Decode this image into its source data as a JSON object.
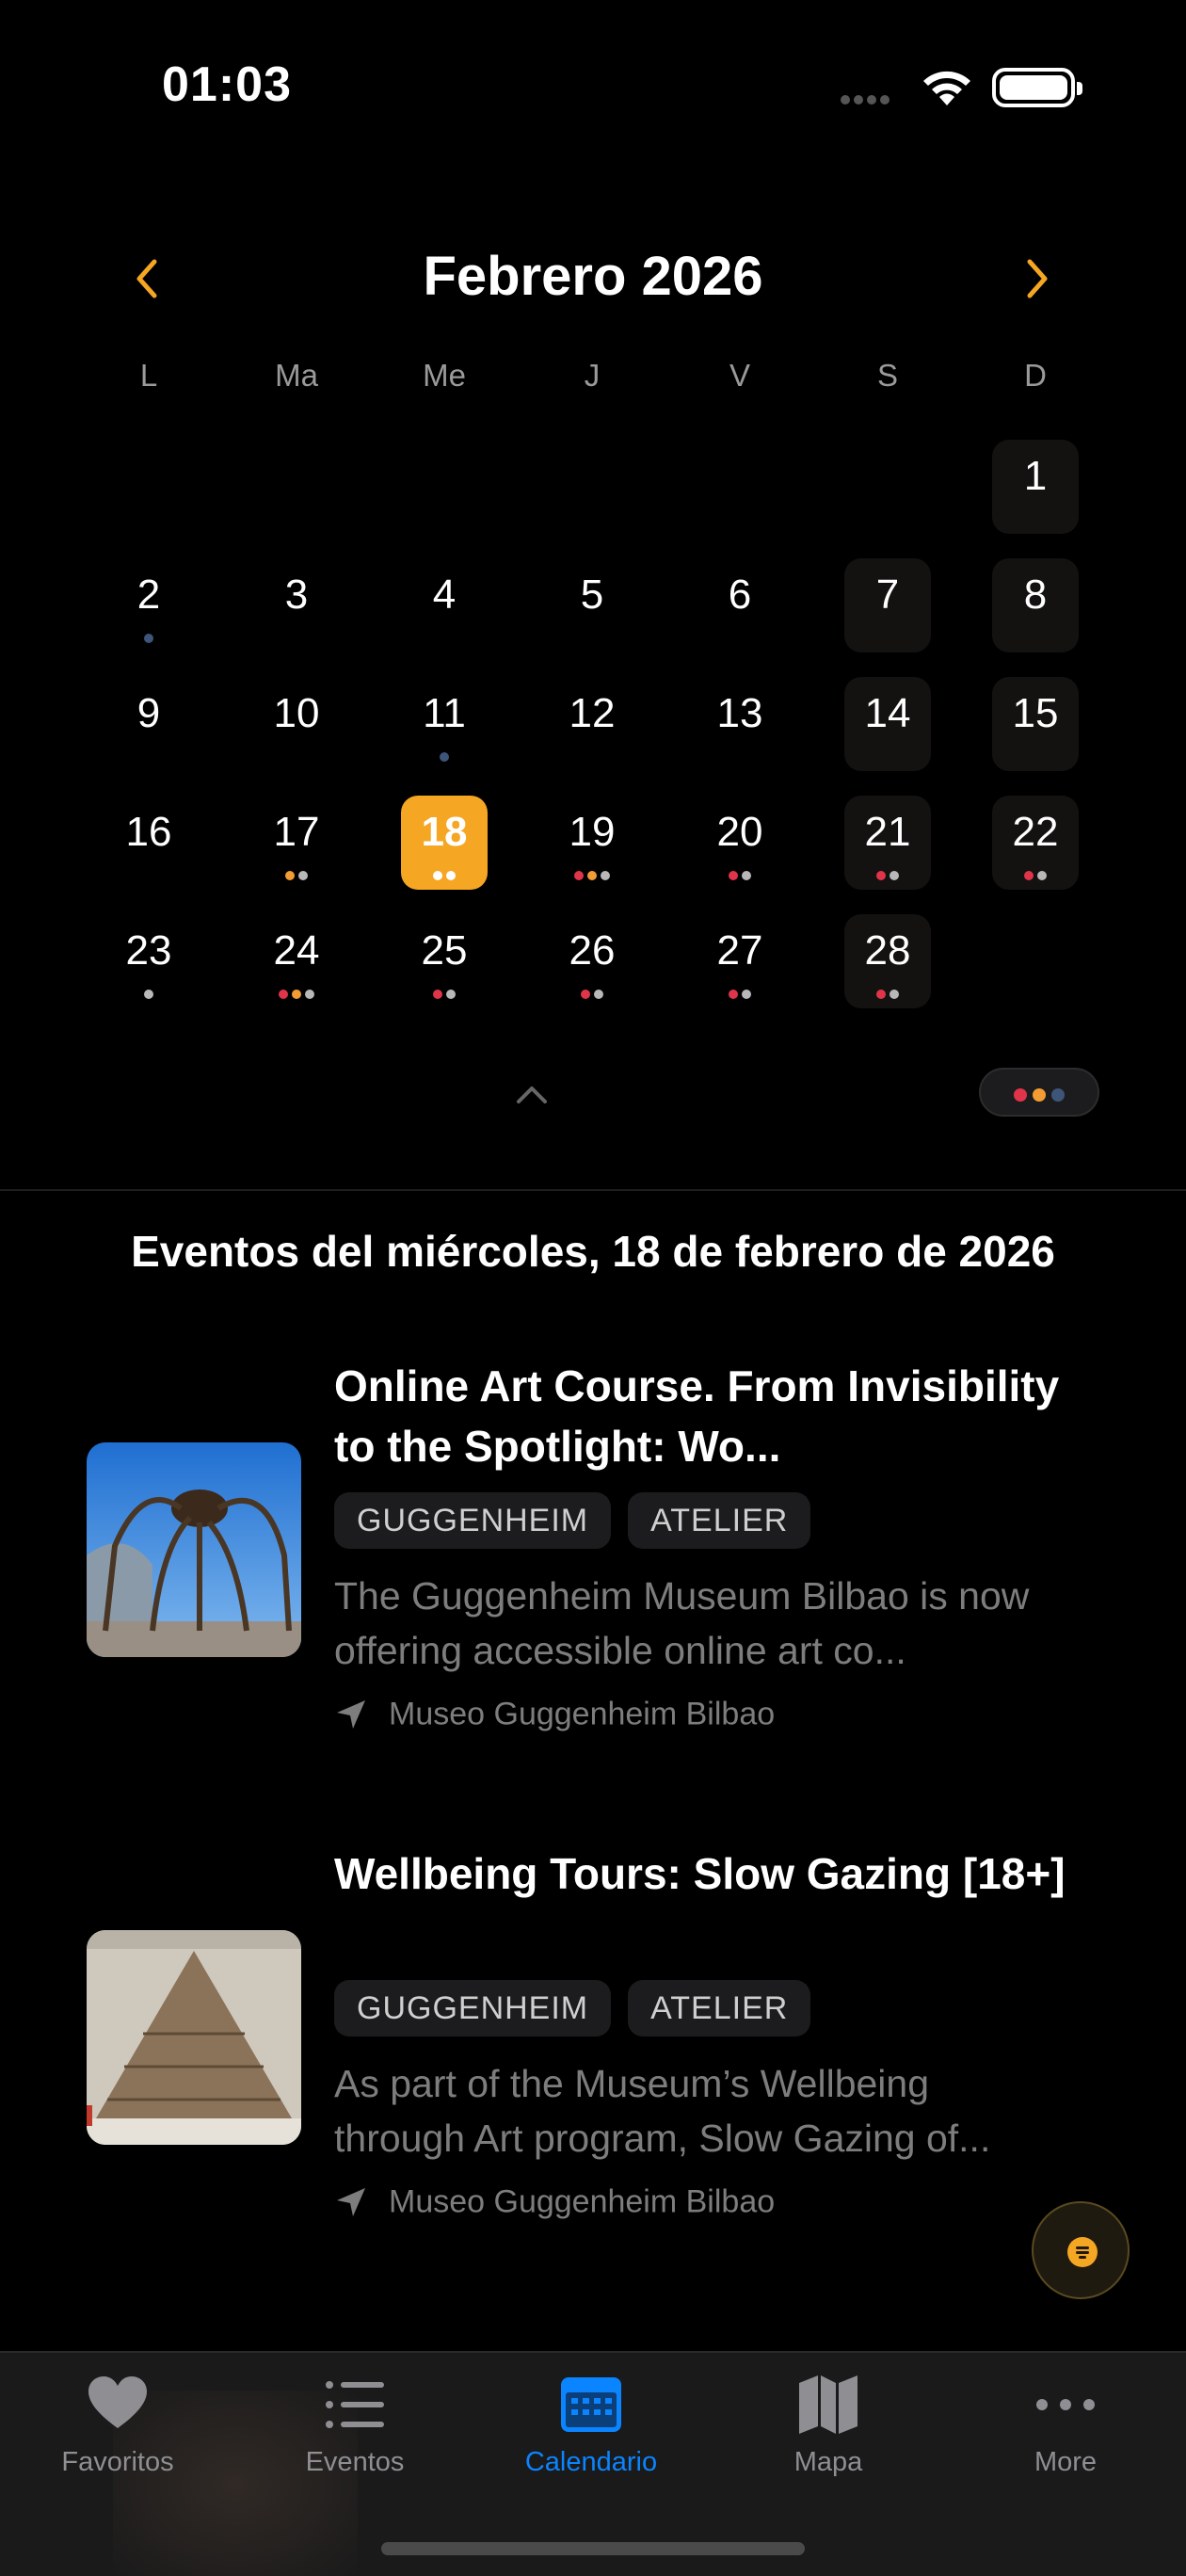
{
  "status_bar": {
    "time": "01:03"
  },
  "calendar": {
    "month_title": "Febrero 2026",
    "weekdays": [
      "L",
      "Ma",
      "Me",
      "J",
      "V",
      "S",
      "D"
    ],
    "accent_color": "#f5a623",
    "dot_colors": {
      "red": "#e0344a",
      "orange": "#f39c34",
      "blue": "#3d5578",
      "gray": "#b8b8b8"
    },
    "days": [
      {
        "n": "1",
        "dots": []
      },
      {
        "n": "2",
        "dots": [
          "blue"
        ]
      },
      {
        "n": "3",
        "dots": []
      },
      {
        "n": "4",
        "dots": []
      },
      {
        "n": "5",
        "dots": []
      },
      {
        "n": "6",
        "dots": []
      },
      {
        "n": "7",
        "dots": []
      },
      {
        "n": "8",
        "dots": []
      },
      {
        "n": "9",
        "dots": []
      },
      {
        "n": "10",
        "dots": []
      },
      {
        "n": "11",
        "dots": [
          "blue"
        ]
      },
      {
        "n": "12",
        "dots": []
      },
      {
        "n": "13",
        "dots": []
      },
      {
        "n": "14",
        "dots": []
      },
      {
        "n": "15",
        "dots": []
      },
      {
        "n": "16",
        "dots": []
      },
      {
        "n": "17",
        "dots": [
          "orange",
          "gray"
        ]
      },
      {
        "n": "18",
        "dots": [
          "white",
          "white"
        ],
        "today": true
      },
      {
        "n": "19",
        "dots": [
          "red",
          "orange",
          "gray"
        ]
      },
      {
        "n": "20",
        "dots": [
          "red",
          "gray"
        ]
      },
      {
        "n": "21",
        "dots": [
          "red",
          "gray"
        ]
      },
      {
        "n": "22",
        "dots": [
          "red",
          "gray"
        ]
      },
      {
        "n": "23",
        "dots": [
          "gray"
        ]
      },
      {
        "n": "24",
        "dots": [
          "red",
          "orange",
          "gray"
        ]
      },
      {
        "n": "25",
        "dots": [
          "red",
          "gray"
        ]
      },
      {
        "n": "26",
        "dots": [
          "red",
          "gray"
        ]
      },
      {
        "n": "27",
        "dots": [
          "red",
          "gray"
        ]
      },
      {
        "n": "28",
        "dots": [
          "red",
          "gray"
        ]
      }
    ]
  },
  "events_heading": "Eventos del miércoles, 18 de febrero de 2026",
  "events": [
    {
      "title": "Online Art Course. From Invisibility to the Spotlight: Wo...",
      "tags": [
        "GUGGENHEIM",
        "ATELIER"
      ],
      "description": "The Guggenheim Museum Bilbao is now offering accessible online art co...",
      "location": "Museo Guggenheim Bilbao"
    },
    {
      "title": "Wellbeing Tours: Slow Gazing [18+]",
      "tags": [
        "GUGGENHEIM",
        "ATELIER"
      ],
      "description": "As part of the Museum’s Wellbeing through Art program, Slow Gazing of...",
      "location": "Museo Guggenheim Bilbao"
    }
  ],
  "tab_bar": {
    "active_color": "#0a84ff",
    "tabs": [
      {
        "label": "Favoritos",
        "icon": "heart-icon"
      },
      {
        "label": "Eventos",
        "icon": "list-icon"
      },
      {
        "label": "Calendario",
        "icon": "calendar-icon",
        "active": true
      },
      {
        "label": "Mapa",
        "icon": "map-icon"
      },
      {
        "label": "More",
        "icon": "more-icon"
      }
    ]
  }
}
